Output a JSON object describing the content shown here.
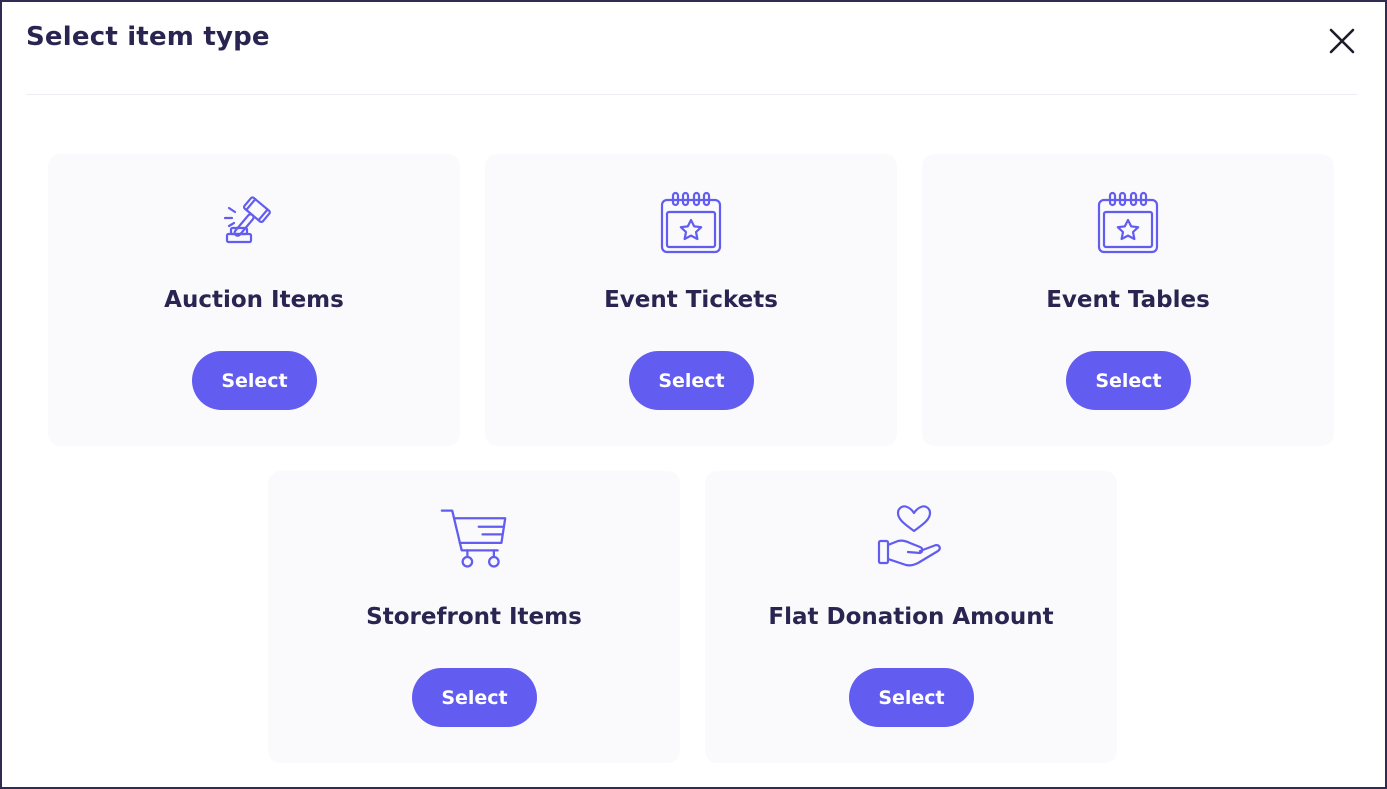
{
  "dialog": {
    "title": "Select item type",
    "close_icon": "close-icon"
  },
  "accent_color": "#625df0",
  "cards": [
    {
      "label": "Auction Items",
      "icon": "gavel-icon",
      "button_label": "Select"
    },
    {
      "label": "Event Tickets",
      "icon": "calendar-star-icon",
      "button_label": "Select"
    },
    {
      "label": "Event Tables",
      "icon": "calendar-star-icon",
      "button_label": "Select"
    },
    {
      "label": "Storefront Items",
      "icon": "shopping-cart-icon",
      "button_label": "Select"
    },
    {
      "label": "Flat Donation Amount",
      "icon": "hand-heart-icon",
      "button_label": "Select"
    }
  ]
}
